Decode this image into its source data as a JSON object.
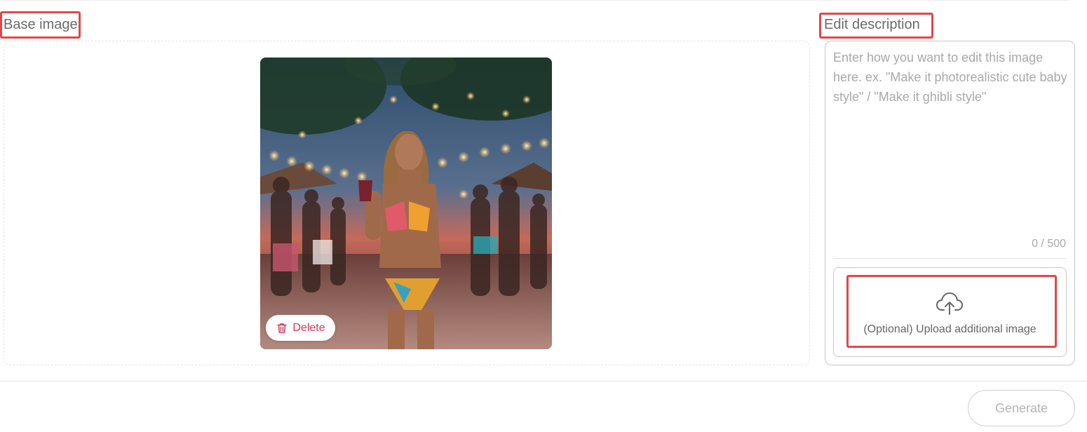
{
  "base_image": {
    "label": "Base image",
    "delete_label": "Delete"
  },
  "edit": {
    "label": "Edit description",
    "placeholder": "Enter how you want to edit this image here. ex. \"Make it photorealistic cute baby style\" / \"Make it ghibli style\"",
    "value": "",
    "counter": "0 / 500"
  },
  "upload": {
    "label": "(Optional) Upload additional image",
    "icon": "cloud-upload-icon"
  },
  "actions": {
    "generate_label": "Generate"
  },
  "colors": {
    "highlight": "#e0484b",
    "delete": "#d6365a",
    "disabled_text": "#b5b5b5"
  }
}
